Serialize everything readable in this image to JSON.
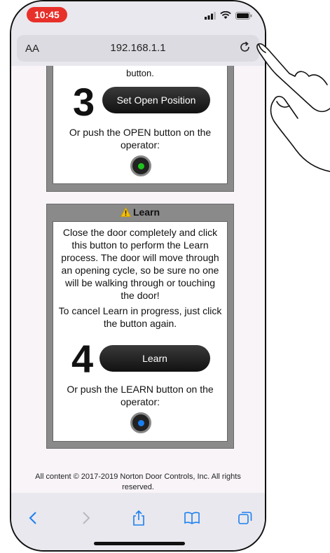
{
  "status": {
    "time": "10:45"
  },
  "address_bar": {
    "aa_label": "AA",
    "url": "192.168.1.1"
  },
  "card_open": {
    "cut_text": "button.",
    "step_number": "3",
    "button_label": "Set Open Position",
    "instruction": "Or push the OPEN button on the operator:",
    "led_color": "#1ec41e"
  },
  "card_learn": {
    "title": "Learn",
    "description": "Close the door completely and click this button to perform the Learn process. The door will move through an opening cycle, so be sure no one will be walking through or touching the door!",
    "cancel_note": "To cancel Learn in progress, just click the button again.",
    "step_number": "4",
    "button_label": "Learn",
    "instruction": "Or push the LEARN button on the operator:",
    "led_color": "#1a7ff0"
  },
  "footer": {
    "copyright": "All content © 2017-2019 Norton Door Controls, Inc. All rights reserved."
  },
  "toolbar": {
    "icons": [
      "back-icon",
      "forward-icon",
      "share-icon",
      "bookmarks-icon",
      "tabs-icon"
    ]
  },
  "colors": {
    "time_badge": "#e8302b",
    "accent": "#1a7ff0",
    "card_frame": "#8a8a8a"
  }
}
